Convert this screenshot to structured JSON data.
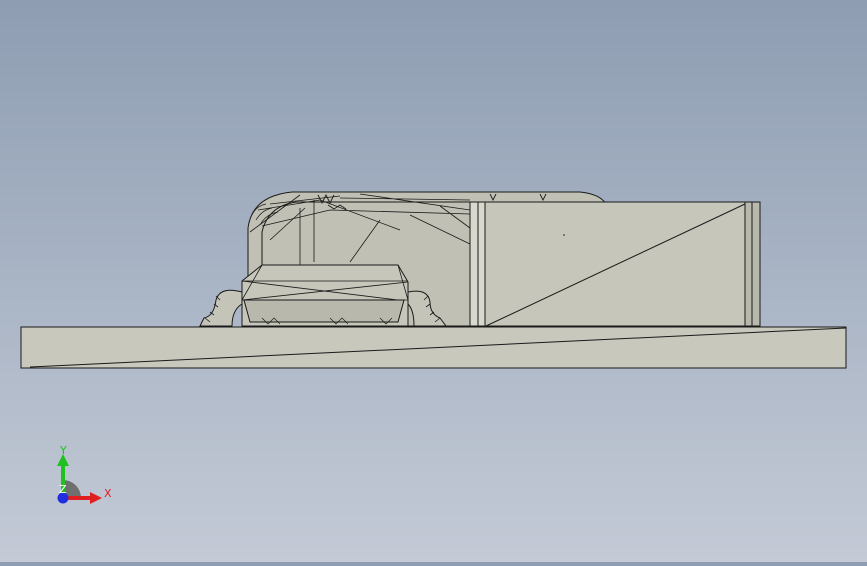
{
  "triad": {
    "x_label": "X",
    "y_label": "Y",
    "z_label": "Z",
    "x_color": "#e02020",
    "y_color": "#20c020",
    "z_color": "#2030e0"
  },
  "model": {
    "face_color": "#c2c2b6",
    "edge_color": "#1a1a1a",
    "components": [
      {
        "name": "base-plate",
        "visible": true
      },
      {
        "name": "rounded-housing",
        "visible": true
      },
      {
        "name": "chip-package",
        "visible": true
      },
      {
        "name": "rectangular-block",
        "visible": true
      }
    ]
  }
}
